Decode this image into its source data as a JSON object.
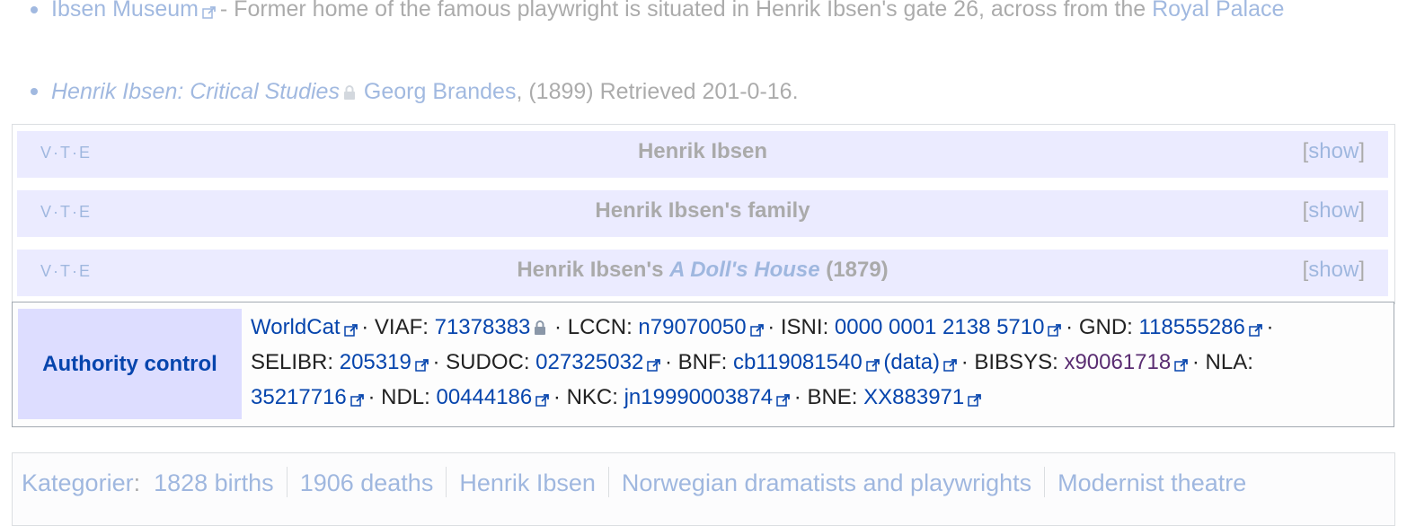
{
  "references": [
    {
      "link_text": "Ibsen Museum",
      "text": " - Former home of the famous playwright is situated in Henrik Ibsen's gate 26, across from the ",
      "link2_text": "Royal Palace"
    },
    {
      "title": "Henrik Ibsen: Critical Studies",
      "author": "Georg Brandes",
      "rest": ", (1899) Retrieved 201-0-16."
    }
  ],
  "navboxes": [
    {
      "v": "V",
      "t": "T",
      "e": "E",
      "title": "Henrik Ibsen",
      "show": "show"
    },
    {
      "v": "V",
      "t": "T",
      "e": "E",
      "title": "Henrik Ibsen's family",
      "show": "show"
    },
    {
      "v": "V",
      "t": "T",
      "e": "E",
      "title_prefix": "Henrik Ibsen's ",
      "title_italic": "A Doll's House",
      "title_suffix": " (1879)",
      "show": "show"
    }
  ],
  "authority": {
    "group_label": "Authority control",
    "items": [
      {
        "label": "WorldCat",
        "value": ""
      },
      {
        "label": "VIAF",
        "value": "71378383"
      },
      {
        "label": "LCCN",
        "value": "n79070050"
      },
      {
        "label": "ISNI",
        "value": "0000 0001 2138 5710"
      },
      {
        "label": "GND",
        "value": "118555286"
      },
      {
        "label": "SELIBR",
        "value": "205319"
      },
      {
        "label": "SUDOC",
        "value": "027325032"
      },
      {
        "label": "BNF",
        "value": "cb119081540",
        "extra": "(data)"
      },
      {
        "label": "BIBSYS",
        "value": "x90061718"
      },
      {
        "label": "NLA",
        "value": "35217716"
      },
      {
        "label": "NDL",
        "value": "00444186"
      },
      {
        "label": "NKC",
        "value": "jn19990003874"
      },
      {
        "label": "BNE",
        "value": "XX883971"
      }
    ]
  },
  "categories": {
    "label": "Kategorier",
    "items": [
      "1828 births",
      "1906 deaths",
      "Henrik Ibsen",
      "Norwegian dramatists and playwrights",
      "Modernist theatre"
    ]
  },
  "colors": {
    "link": "#0645ad",
    "visited": "#5a2d72",
    "navbox_title_bg": "#ccccff",
    "group_bg": "#ddddff"
  }
}
